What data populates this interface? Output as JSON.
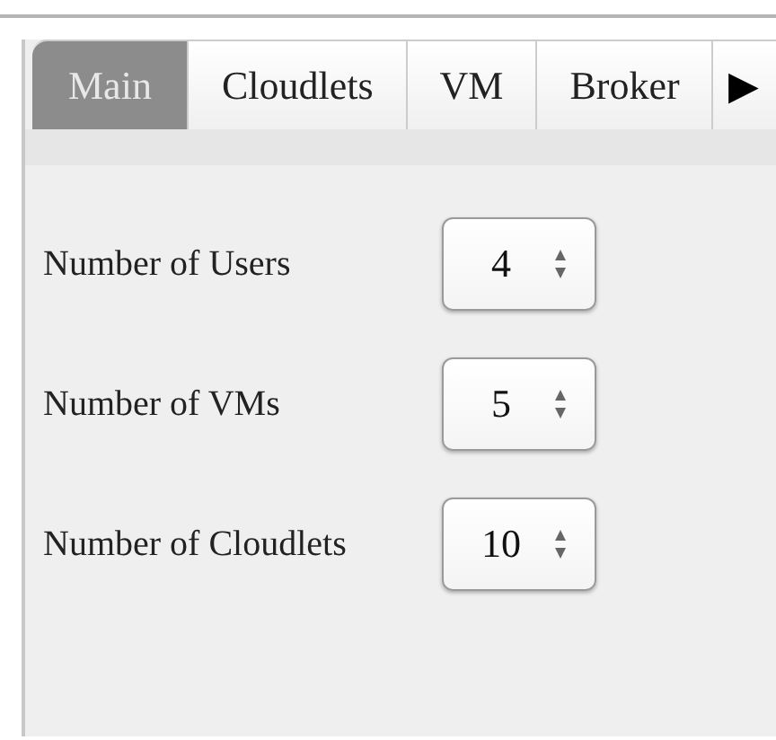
{
  "tabs": [
    {
      "label": "Main",
      "selected": true
    },
    {
      "label": "Cloudlets",
      "selected": false
    },
    {
      "label": "VM",
      "selected": false
    },
    {
      "label": "Broker",
      "selected": false
    }
  ],
  "tab_scroll": "▶",
  "fields": [
    {
      "label": "Number of Users",
      "value": "4"
    },
    {
      "label": "Number of VMs",
      "value": "5"
    },
    {
      "label": "Number of Cloudlets",
      "value": "10"
    }
  ]
}
